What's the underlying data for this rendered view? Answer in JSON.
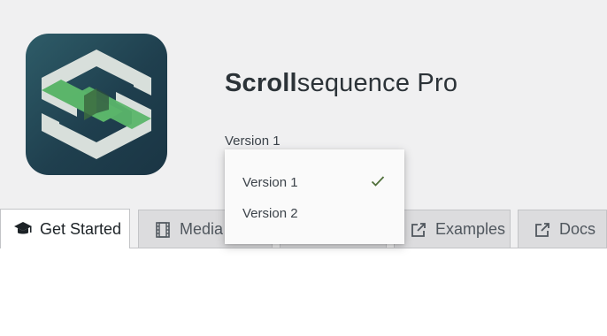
{
  "product": {
    "title_bold": "Scroll",
    "title_rest": "sequence Pro",
    "logo_icon": "scrollsequence-logo-icon"
  },
  "version_selector": {
    "current": "Version 1",
    "options": [
      {
        "label": "Version 1",
        "selected": true
      },
      {
        "label": "Version 2",
        "selected": false
      }
    ]
  },
  "tabs": [
    {
      "label": "Get Started",
      "icon": "graduation-cap-icon",
      "active": true
    },
    {
      "label": "Media",
      "icon": "film-icon",
      "active": false
    },
    {
      "label": "Examples",
      "icon": "external-link-icon",
      "active": false
    },
    {
      "label": "Docs",
      "icon": "external-link-icon",
      "active": false
    }
  ],
  "colors": {
    "header_bg": "#f0f0f1",
    "logo_dark": "#1f3f4e",
    "logo_green": "#5bb56a",
    "check_green": "#4f6f3a"
  }
}
